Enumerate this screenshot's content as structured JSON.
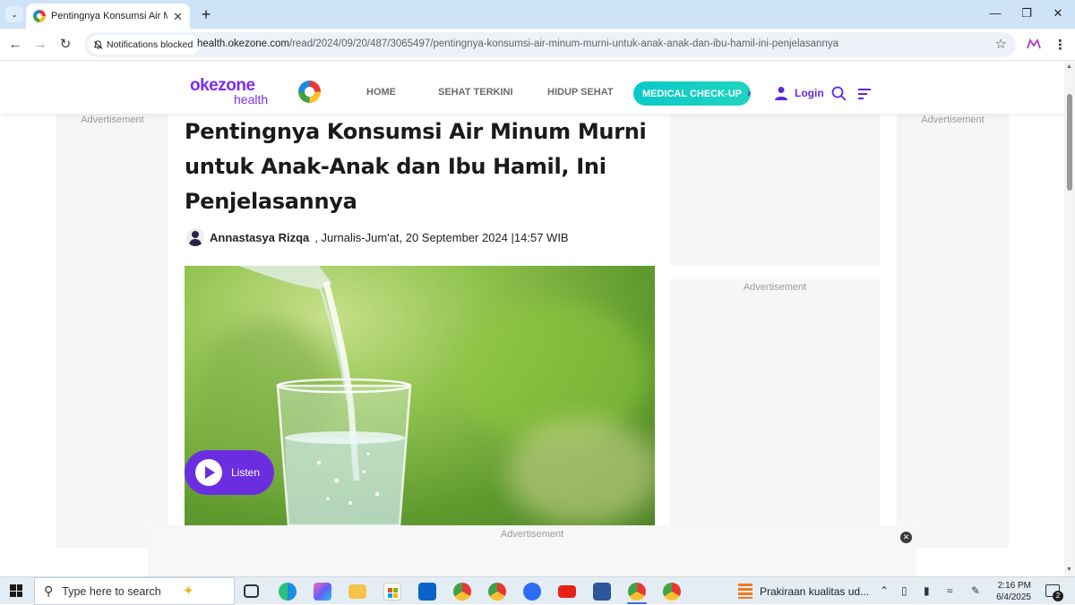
{
  "browser": {
    "tab_title": "Pentingnya Konsumsi Air Minum",
    "notification_chip": "Notifications blocked",
    "url_host": "health.okezone.com",
    "url_path": "/read/2024/09/20/487/3065497/pentingnya-konsumsi-air-minum-murni-untuk-anak-anak-dan-ibu-hamil-ini-penjelasannya",
    "new_tab": "+",
    "tab_close": "✕"
  },
  "site": {
    "logo_main": "okezone",
    "logo_sub": "health",
    "nav": [
      "HOME",
      "SEHAT TERKINI",
      "HIDUP SEHAT"
    ],
    "cta": "MEDICAL CHECK-UP",
    "login": "Login",
    "accent_color": "#7b2cf0",
    "cta_color": "#0bc9c9"
  },
  "ads": {
    "label": "Advertisement"
  },
  "article": {
    "headline": "Pentingnya Konsumsi Air Minum Murni untuk Anak-Anak dan Ibu Hamil, Ini Penjelasannya",
    "author": "Annastasya Rizqa",
    "byline_rest": ", Jurnalis-Jum'at, 20 September 2024 |14:57 WIB",
    "listen_label": "Listen"
  },
  "taskbar": {
    "search_placeholder": "Type here to search",
    "weather_text": "Prakiraan kualitas ud...",
    "time": "2:16 PM",
    "date": "6/4/2025",
    "notification_count": "2",
    "apps": [
      "task-view",
      "edge",
      "copilot",
      "file-explorer",
      "microsoft-store",
      "outlook",
      "chrome-profile-1",
      "chrome-profile-2",
      "zoom",
      "youtube",
      "word",
      "chrome-active",
      "chrome"
    ]
  }
}
